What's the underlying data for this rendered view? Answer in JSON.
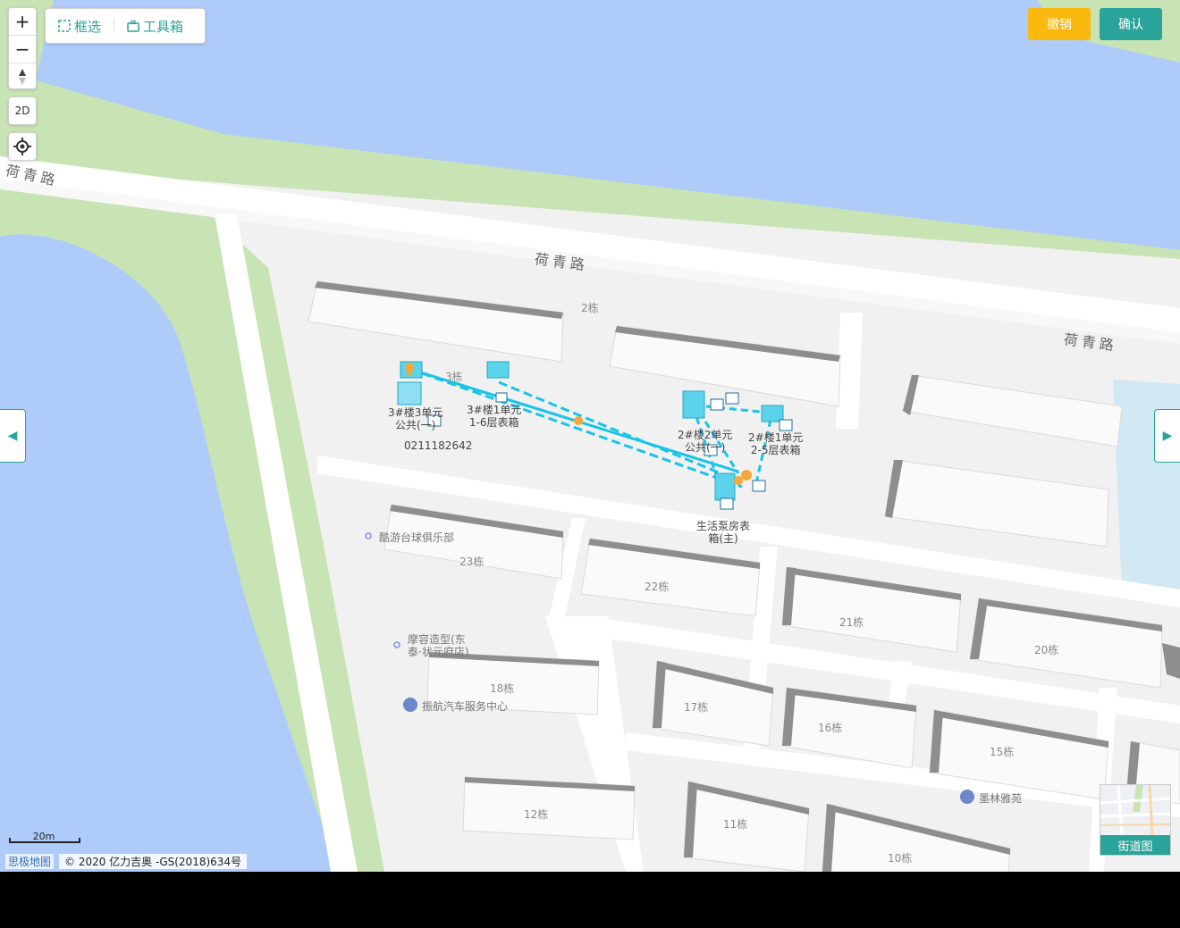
{
  "toolbar": {
    "select_label": "框选",
    "toolbox_label": "工具箱"
  },
  "map_controls": {
    "zoom_in": "+",
    "zoom_out": "−",
    "view_mode": "2D",
    "compass_icon": "compass-icon",
    "locate_icon": "locate-icon"
  },
  "actions": {
    "cancel_label": "撤销",
    "confirm_label": "确认",
    "cancel_color": "#fbb80f",
    "confirm_color": "#2aa39a"
  },
  "roads": {
    "north_1": "荷青路",
    "north_2": "荷青路",
    "north_3": "荷青路"
  },
  "buildings": [
    "2栋",
    "3栋",
    "23栋",
    "22栋",
    "21栋",
    "20栋",
    "18栋",
    "17栋",
    "16栋",
    "15栋",
    "12栋",
    "11栋",
    "10栋"
  ],
  "pois": {
    "poi_1": "酷游台球俱乐部",
    "poi_2": "摩容造型(东泰·状元府店)",
    "poi_3": "振航汽车服务中心",
    "poi_4": "墨林雅苑"
  },
  "devices": {
    "d1": "3#楼3单元\n公共(一)",
    "d2": "3#楼1单元\n1-6层表箱",
    "d3": "2#楼2单元\n公共(一)",
    "d4": "2#楼1单元\n2-5层表箱",
    "d5": "生活泵房表\n箱(主)",
    "phone": "0211182642"
  },
  "scale_label": "20m",
  "attribution": {
    "logo": "思极地图",
    "copyright": "© 2020 亿力吉奥 -GS(2018)634号"
  },
  "street_view_label": "街道图",
  "colors": {
    "water": "#aecbfa",
    "greenbelt": "#c8e3b4",
    "accent": "#2aa39a",
    "line": "#18c4e8",
    "marker": "#f7a83a"
  }
}
